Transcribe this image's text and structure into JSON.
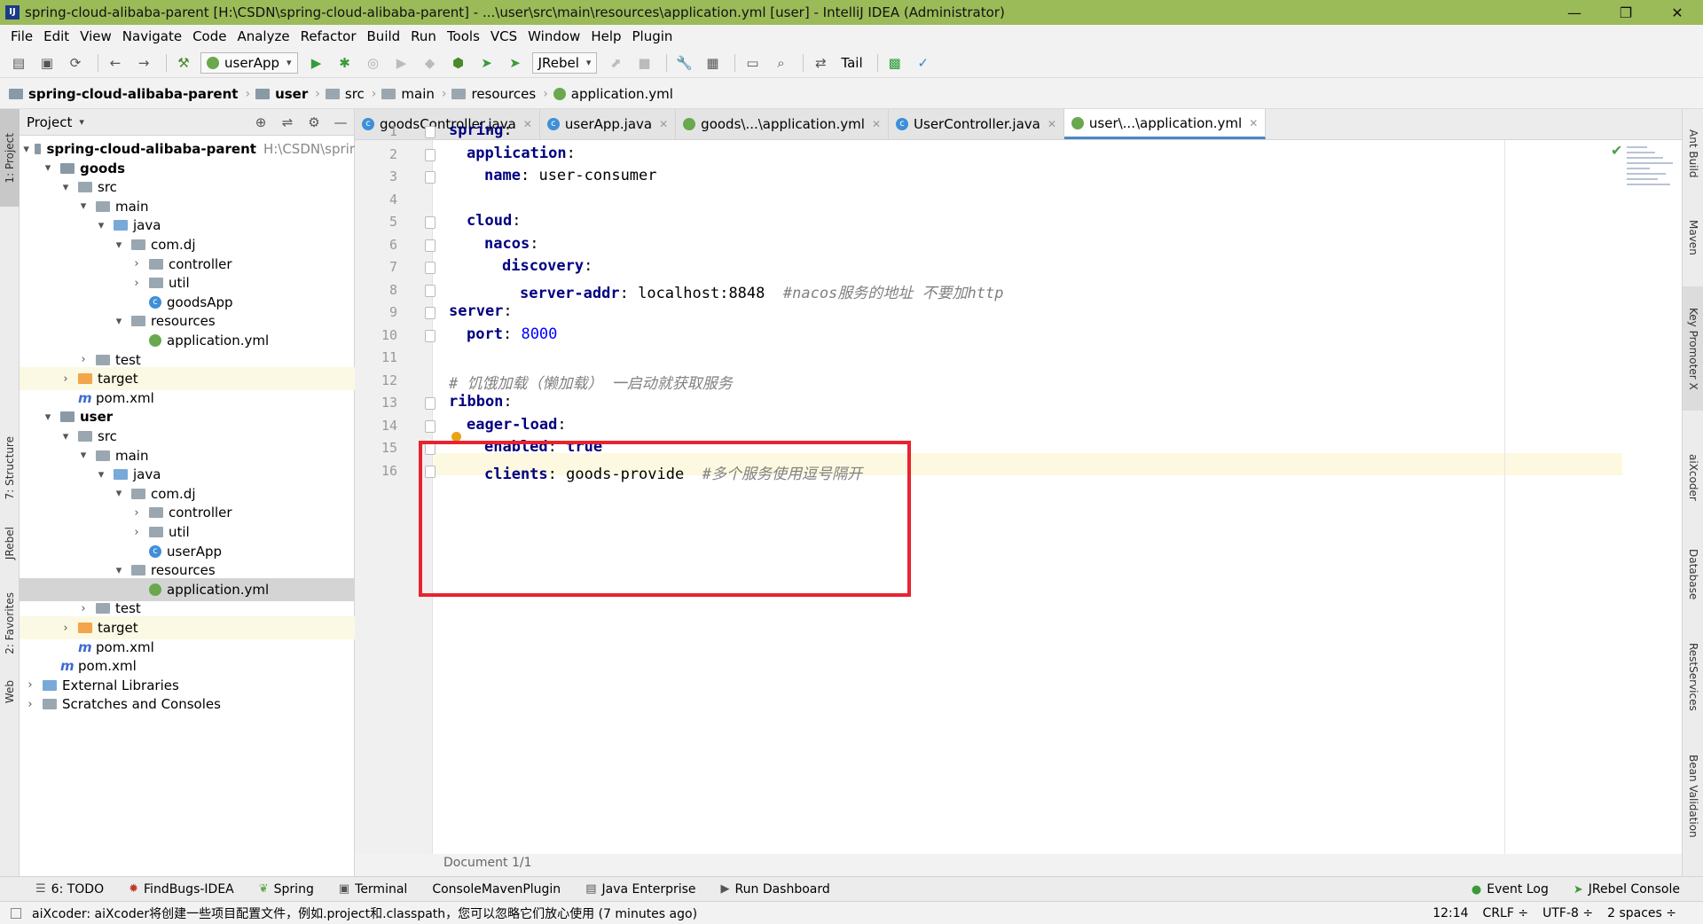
{
  "window": {
    "title": "spring-cloud-alibaba-parent [H:\\CSDN\\spring-cloud-alibaba-parent] - ...\\user\\src\\main\\resources\\application.yml [user] - IntelliJ IDEA (Administrator)",
    "minimize": "—",
    "maximize": "❐",
    "close": "✕"
  },
  "menu": [
    "File",
    "Edit",
    "View",
    "Navigate",
    "Code",
    "Analyze",
    "Refactor",
    "Build",
    "Run",
    "Tools",
    "VCS",
    "Window",
    "Help",
    "Plugin"
  ],
  "toolbar": {
    "run_config": "userApp",
    "jrebel": "JRebel",
    "tail": "Tail"
  },
  "breadcrumb": [
    "spring-cloud-alibaba-parent",
    "user",
    "src",
    "main",
    "resources",
    "application.yml"
  ],
  "project_panel": {
    "title": "Project",
    "tree": [
      {
        "label": "spring-cloud-alibaba-parent",
        "path": "H:\\CSDN\\sprir",
        "icon": "module-folder",
        "bold": true,
        "chev": "▾"
      },
      {
        "label": "goods",
        "icon": "module-folder",
        "bold": true,
        "chev": "▾"
      },
      {
        "label": "src",
        "icon": "folder",
        "chev": "▾"
      },
      {
        "label": "main",
        "icon": "folder",
        "chev": "▾"
      },
      {
        "label": "java",
        "icon": "source-folder",
        "chev": "▾"
      },
      {
        "label": "com.dj",
        "icon": "package",
        "chev": "▾"
      },
      {
        "label": "controller",
        "icon": "package",
        "chev": "›"
      },
      {
        "label": "util",
        "icon": "package",
        "chev": "›"
      },
      {
        "label": "goodsApp",
        "icon": "spring-class",
        "chev": ""
      },
      {
        "label": "resources",
        "icon": "resources-folder",
        "chev": "▾"
      },
      {
        "label": "application.yml",
        "icon": "yml",
        "chev": ""
      },
      {
        "label": "test",
        "icon": "folder",
        "chev": "›"
      },
      {
        "label": "target",
        "icon": "excluded-folder",
        "chev": "›"
      },
      {
        "label": "pom.xml",
        "icon": "maven",
        "chev": ""
      },
      {
        "label": "user",
        "icon": "module-folder",
        "bold": true,
        "chev": "▾"
      },
      {
        "label": "src",
        "icon": "folder",
        "chev": "▾"
      },
      {
        "label": "main",
        "icon": "folder",
        "chev": "▾"
      },
      {
        "label": "java",
        "icon": "source-folder",
        "chev": "▾"
      },
      {
        "label": "com.dj",
        "icon": "package",
        "chev": "▾"
      },
      {
        "label": "controller",
        "icon": "package",
        "chev": "›"
      },
      {
        "label": "util",
        "icon": "package",
        "chev": "›"
      },
      {
        "label": "userApp",
        "icon": "spring-class",
        "chev": ""
      },
      {
        "label": "resources",
        "icon": "resources-folder",
        "chev": "▾"
      },
      {
        "label": "application.yml",
        "icon": "yml",
        "chev": "",
        "selected": true
      },
      {
        "label": "test",
        "icon": "folder",
        "chev": "›"
      },
      {
        "label": "target",
        "icon": "excluded-folder",
        "chev": "›"
      },
      {
        "label": "pom.xml",
        "icon": "maven",
        "chev": ""
      },
      {
        "label": "pom.xml",
        "icon": "maven",
        "chev": ""
      },
      {
        "label": "External Libraries",
        "icon": "library",
        "chev": "›"
      },
      {
        "label": "Scratches and Consoles",
        "icon": "scratches",
        "chev": "›"
      }
    ]
  },
  "editor_tabs": [
    {
      "label": "goodsController.java",
      "icon": "java"
    },
    {
      "label": "userApp.java",
      "icon": "java"
    },
    {
      "label": "goods\\...\\application.yml",
      "icon": "yml"
    },
    {
      "label": "UserController.java",
      "icon": "java"
    },
    {
      "label": "user\\...\\application.yml",
      "icon": "yml",
      "active": true
    }
  ],
  "editor": {
    "lines": [
      {
        "n": "1",
        "key": "spring",
        "value": "",
        "comment": ""
      },
      {
        "n": "2",
        "key": "application",
        "value": "",
        "comment": ""
      },
      {
        "n": "3",
        "key": "name",
        "value": "user-consumer",
        "comment": ""
      },
      {
        "n": "4",
        "key": "",
        "value": "",
        "comment": ""
      },
      {
        "n": "5",
        "key": "cloud",
        "value": "",
        "comment": ""
      },
      {
        "n": "6",
        "key": "nacos",
        "value": "",
        "comment": ""
      },
      {
        "n": "7",
        "key": "discovery",
        "value": "",
        "comment": ""
      },
      {
        "n": "8",
        "key": "server-addr",
        "value": "localhost:8848",
        "comment": "#nacos服务的地址 不要加http"
      },
      {
        "n": "9",
        "key": "server",
        "value": "",
        "comment": ""
      },
      {
        "n": "10",
        "key": "port",
        "value": "8000",
        "comment": ""
      },
      {
        "n": "11",
        "key": "",
        "value": "",
        "comment": ""
      },
      {
        "n": "12",
        "key": "",
        "value": "",
        "comment": "# 饥饿加载（懒加载） 一启动就获取服务"
      },
      {
        "n": "13",
        "key": "ribbon",
        "value": "",
        "comment": ""
      },
      {
        "n": "14",
        "key": "eager-load",
        "value": "",
        "comment": ""
      },
      {
        "n": "15",
        "key": "enabled",
        "value": "true",
        "comment": ""
      },
      {
        "n": "16",
        "key": "clients",
        "value": "goods-provide",
        "comment": "#多个服务使用逗号隔开"
      }
    ],
    "document_status": "Document 1/1"
  },
  "left_strip": [
    "1: Project",
    "7: Structure",
    "JRebel",
    "2: Favorites",
    "Web"
  ],
  "right_strip": [
    "Ant Build",
    "Maven",
    "Key Promoter X",
    "aiXcoder",
    "Database",
    "RestServices",
    "Bean Validation"
  ],
  "bottom_tools": [
    {
      "label": "6: TODO",
      "icon": "todo-icon"
    },
    {
      "label": "FindBugs-IDEA",
      "icon": "bug-icon"
    },
    {
      "label": "Spring",
      "icon": "spring-icon"
    },
    {
      "label": "Terminal",
      "icon": "terminal-icon"
    },
    {
      "label": "ConsoleMavenPlugin",
      "icon": ""
    },
    {
      "label": "Java Enterprise",
      "icon": "enterprise-icon"
    },
    {
      "label": "Run Dashboard",
      "icon": "run-icon"
    }
  ],
  "bottom_tools_right": [
    {
      "label": "Event Log",
      "icon": "event-log-icon"
    },
    {
      "label": "JRebel Console",
      "icon": "jrebel-icon"
    }
  ],
  "status": {
    "message": "aiXcoder: aiXcoder将创建一些项目配置文件，例如.project和.classpath，您可以忽略它们放心使用 (7 minutes ago)",
    "position": "12:14",
    "line_sep": "CRLF ÷",
    "encoding": "UTF-8 ÷",
    "indent": "2 spaces ÷"
  },
  "colors": {
    "titlebar": "#9bbb59",
    "highlight_box": "#e8232f",
    "yaml_key": "#000080",
    "yaml_comment": "#808080"
  }
}
